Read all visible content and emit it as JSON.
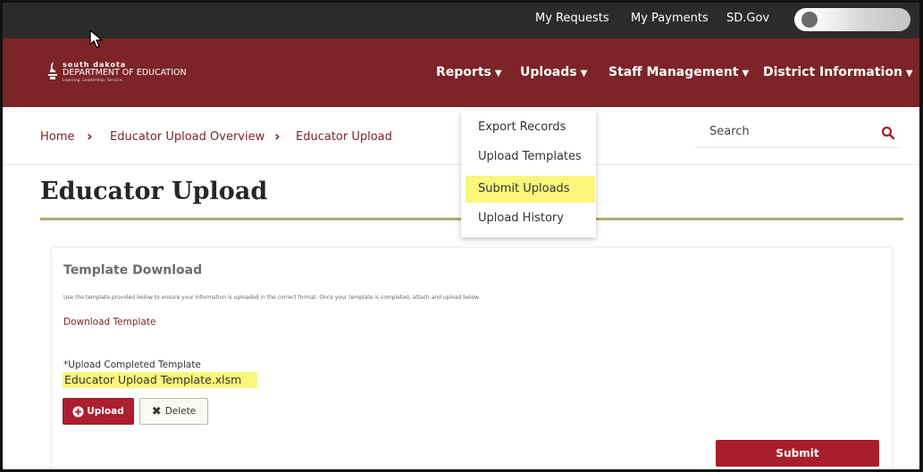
{
  "topbar": {
    "links": [
      "My Requests",
      "My Payments",
      "SD.Gov"
    ]
  },
  "logo": {
    "line1": "south dakota",
    "line2": "DEPARTMENT OF EDUCATION",
    "line3": "Learning. Leadership. Service."
  },
  "nav": {
    "reports": "Reports",
    "uploads": "Uploads",
    "staff": "Staff Management",
    "district": "District Information"
  },
  "breadcrumb": [
    "Home",
    "Educator Upload Overview",
    "Educator Upload"
  ],
  "search": {
    "placeholder": "Search"
  },
  "page": {
    "title": "Educator Upload"
  },
  "card": {
    "title": "Template Download",
    "help": "Use the template provided below to ensure your information is uploaded in the correct format. Once your template is completed, attach and upload below.",
    "download_link": "Download Template",
    "required_mark": "*",
    "upload_label": "Upload Completed Template",
    "file_name": "Educator Upload Template.xlsm",
    "upload_btn": "Upload",
    "delete_btn": "Delete",
    "submit_btn": "Submit"
  },
  "dropdown": {
    "items": [
      "Export Records",
      "Upload Templates",
      "Submit Uploads",
      "Upload History"
    ],
    "highlighted": "Submit Uploads"
  },
  "colors": {
    "brand": "#7c2427",
    "accent_button": "#ad1f30",
    "highlight": "#fcf67c",
    "title_rule": "#b2a66f",
    "topbar": "#2b2b2b"
  },
  "icons": [
    "search-icon",
    "plus-circle-icon",
    "x-icon",
    "caret-down-icon",
    "chevron-right-icon",
    "logo-mark-icon",
    "mouse-pointer-icon"
  ]
}
